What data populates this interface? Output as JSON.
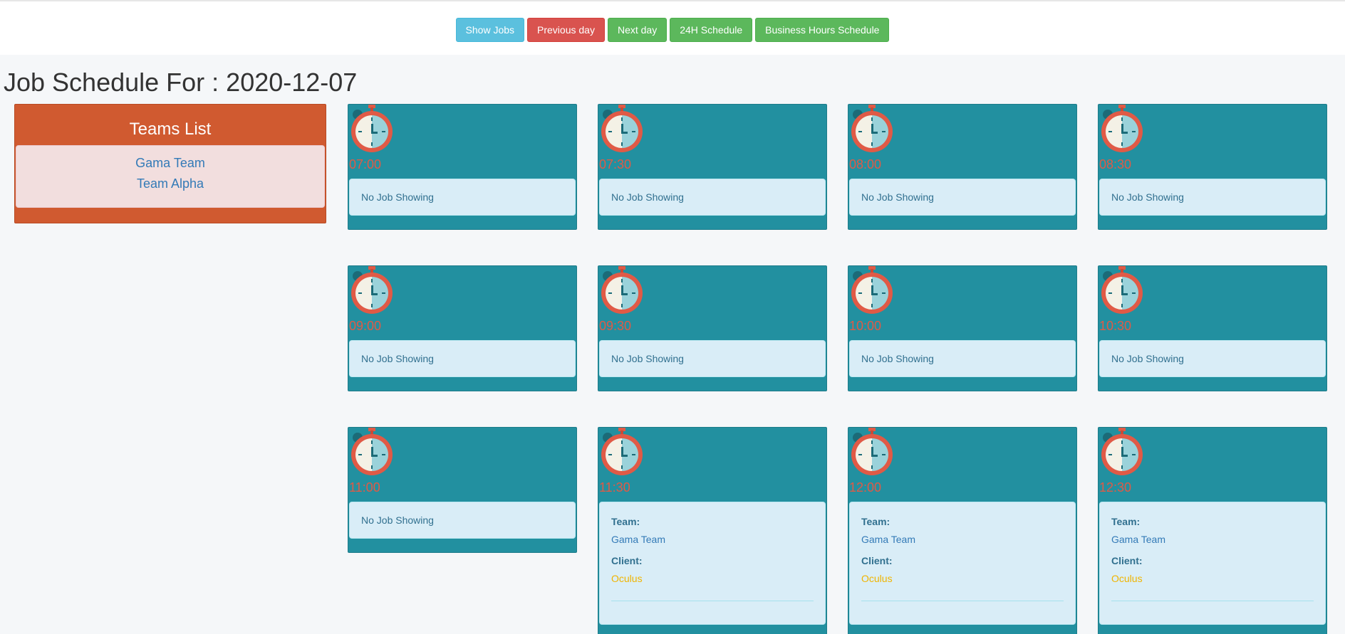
{
  "toolbar": {
    "show_jobs": "Show Jobs",
    "previous_day": "Previous day",
    "next_day": "Next day",
    "schedule_24h": "24H Schedule",
    "business_hours": "Business Hours Schedule"
  },
  "page": {
    "title": "Job Schedule For : 2020-12-07"
  },
  "teams": {
    "title": "Teams List",
    "items": [
      "Gama Team",
      "Team Alpha"
    ]
  },
  "empty_text": "No Job Showing",
  "slots": [
    {
      "time": "07:00",
      "has_job": false
    },
    {
      "time": "07:30",
      "has_job": false
    },
    {
      "time": "08:00",
      "has_job": false
    },
    {
      "time": "08:30",
      "has_job": false
    },
    {
      "time": "09:00",
      "has_job": false
    },
    {
      "time": "09:30",
      "has_job": false
    },
    {
      "time": "10:00",
      "has_job": false
    },
    {
      "time": "10:30",
      "has_job": false
    },
    {
      "time": "11:00",
      "has_job": false
    },
    {
      "time": "11:30",
      "has_job": true,
      "team_label": "Team:",
      "team": "Gama Team",
      "client_label": "Client:",
      "client": "Oculus"
    },
    {
      "time": "12:00",
      "has_job": true,
      "team_label": "Team:",
      "team": "Gama Team",
      "client_label": "Client:",
      "client": "Oculus"
    },
    {
      "time": "12:30",
      "has_job": true,
      "team_label": "Team:",
      "team": "Gama Team",
      "client_label": "Client:",
      "client": "Oculus"
    }
  ],
  "colors": {
    "slot_bg": "#2290a0",
    "teams_panel": "#d05a30",
    "time_text": "#e05a46",
    "client_text": "#f0b400"
  },
  "icons": {
    "slot_icon": "stopwatch-icon"
  }
}
